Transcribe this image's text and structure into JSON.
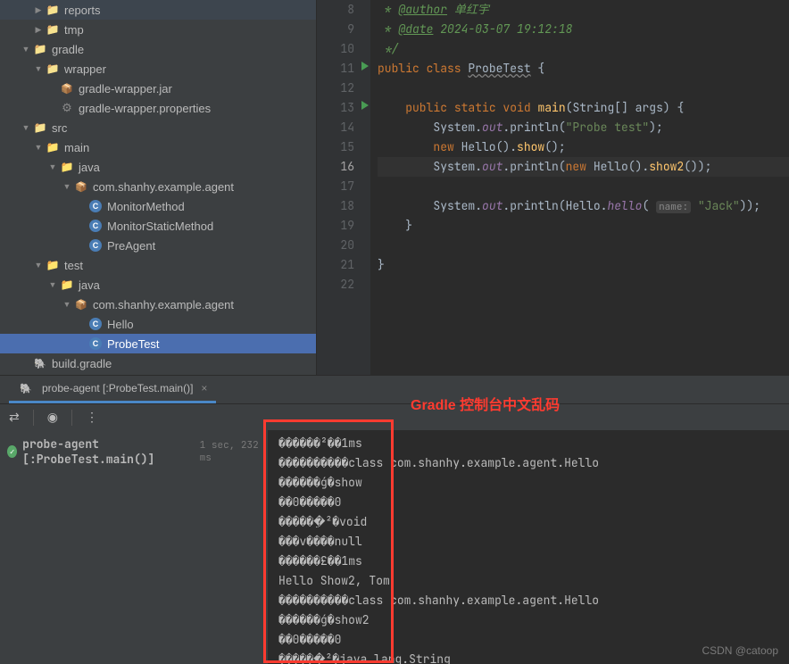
{
  "tree": {
    "reports": "reports",
    "tmp": "tmp",
    "gradle": "gradle",
    "wrapper": "wrapper",
    "wrapper_jar": "gradle-wrapper.jar",
    "wrapper_props": "gradle-wrapper.properties",
    "src": "src",
    "main": "main",
    "java": "java",
    "pkg": "com.shanhy.example.agent",
    "monitor_method": "MonitorMethod",
    "monitor_static": "MonitorStaticMethod",
    "pre_agent": "PreAgent",
    "test": "test",
    "hello": "Hello",
    "probe_test": "ProbeTest",
    "build_gradle": "build.gradle"
  },
  "editor": {
    "lines": {
      "l8a": " * ",
      "l8b": "@author",
      "l8c": " 单红宇",
      "l9a": " * ",
      "l9b": "@date",
      "l9c": " 2024-03-07 19:12:18",
      "l10": " */",
      "l11_public": "public ",
      "l11_class": "class ",
      "l11_name": "ProbeTest",
      "l11_brace": " {",
      "l13_public": "    public ",
      "l13_static": "static ",
      "l13_void": "void ",
      "l13_main": "main",
      "l13_paren": "(",
      "l13_string": "String",
      "l13_arr": "[] ",
      "l13_args": "args",
      "l13_end": ") {",
      "l14_pre": "        System.",
      "l14_out": "out",
      "l14_print": ".println(",
      "l14_str": "\"Probe test\"",
      "l14_end": ");",
      "l15_new": "        new ",
      "l15_hello": "Hello().",
      "l15_show": "show",
      "l15_end": "();",
      "l16_pre": "        System.",
      "l16_out": "out",
      "l16_print": ".println(",
      "l16_new": "new ",
      "l16_hello": "Hello().",
      "l16_show2": "show2",
      "l16_end": "());",
      "l18_pre": "        System.",
      "l18_out": "out",
      "l18_print": ".println(Hello.",
      "l18_hello": "hello",
      "l18_param": "name:",
      "l18_str": "\"Jack\"",
      "l18_end": "));",
      "l19": "    }",
      "l21": "}"
    },
    "line_numbers": [
      "8",
      "9",
      "10",
      "11",
      "12",
      "13",
      "14",
      "15",
      "16",
      "17",
      "18",
      "19",
      "20",
      "21",
      "22"
    ]
  },
  "bottom_tab": {
    "label": "probe-agent [:ProbeTest.main()]"
  },
  "annotation": {
    "text": "Gradle 控制台中文乱码"
  },
  "console": {
    "task_name": "probe-agent [:ProbeTest.main()]",
    "task_time": "1 sec, 232 ms",
    "output": [
      "������²��1ms",
      "����������class com.shanhy.example.agent.Hello",
      "������ǵ�show",
      "��0�����0",
      "������ֵ²�void",
      "���v����null",
      "������£��1ms",
      "Hello Show2, Tom",
      "����������class com.shanhy.example.agent.Hello",
      "������ǵ�show2",
      "��0�����0",
      "������ֵ²�java.lang.String"
    ]
  },
  "watermark": "CSDN @catoop"
}
